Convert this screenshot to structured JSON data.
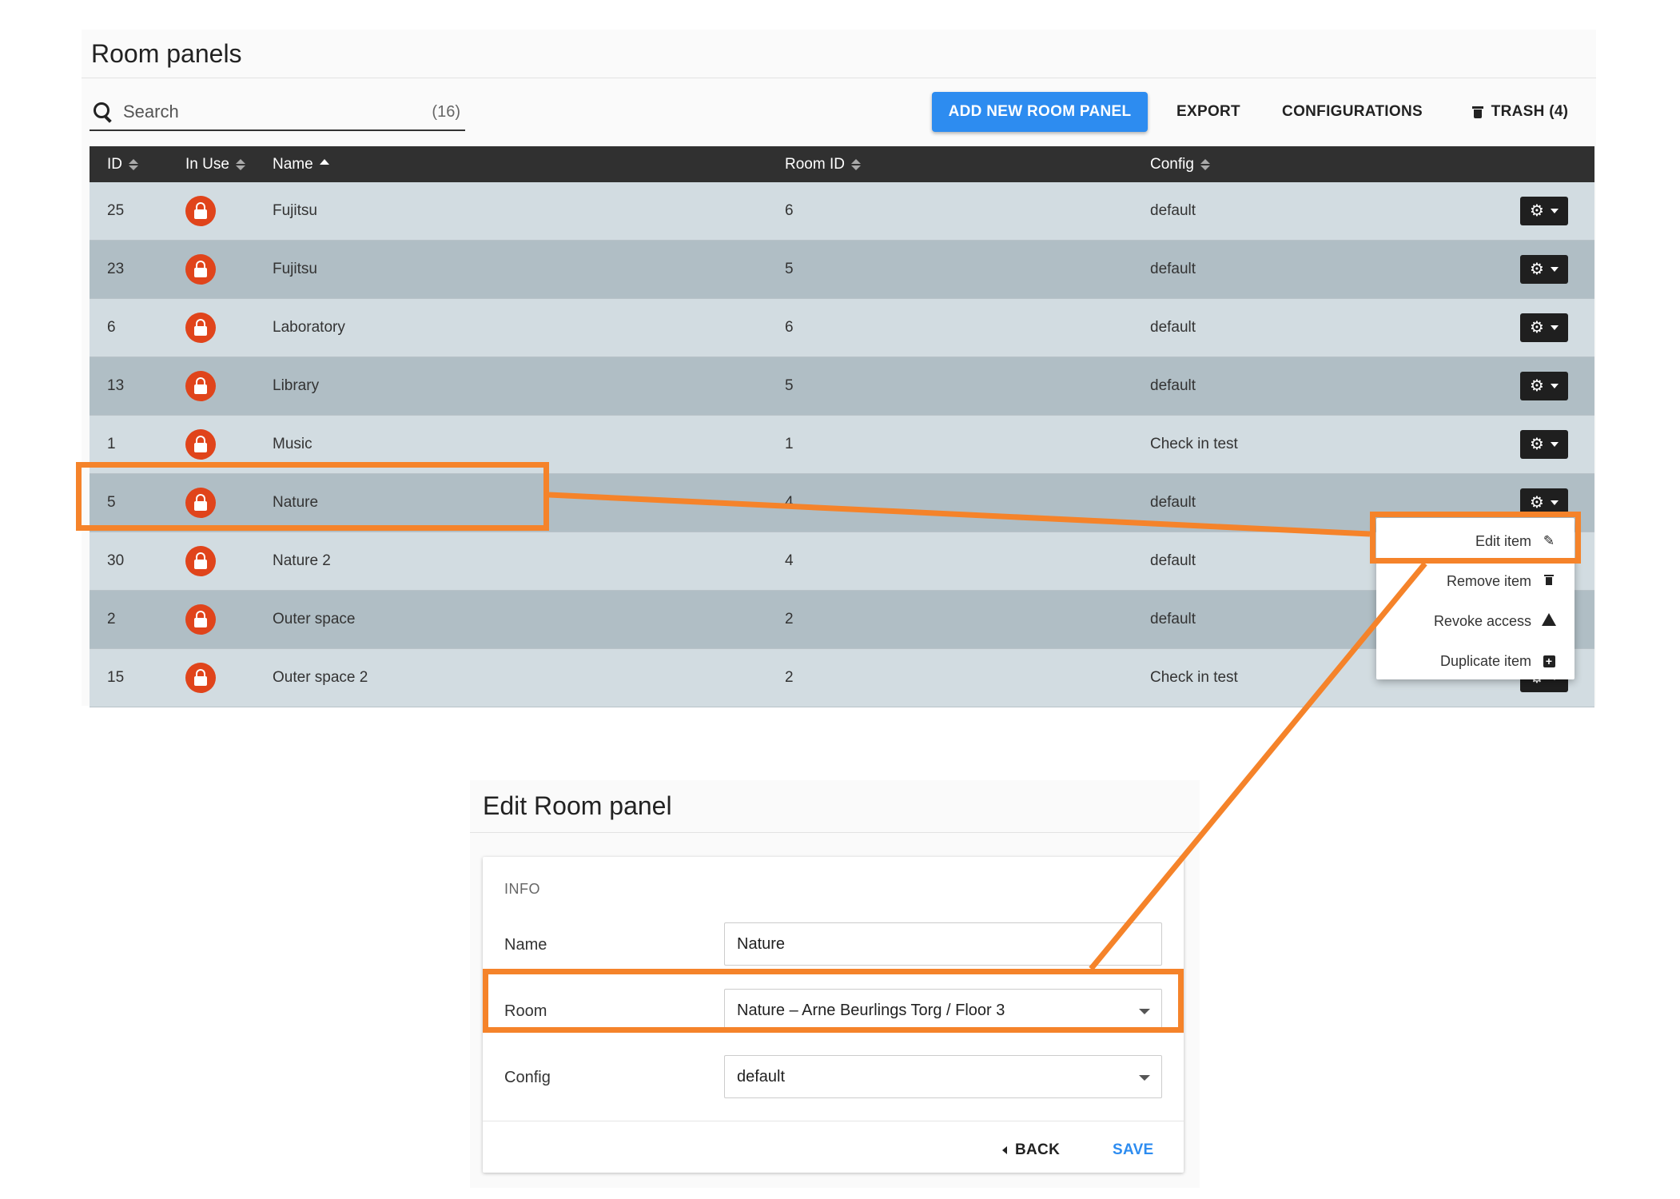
{
  "list_page": {
    "title": "Room panels",
    "search": {
      "placeholder": "Search",
      "value": "",
      "count": "(16)"
    },
    "toolbar": {
      "add_label": "ADD NEW ROOM PANEL",
      "export_label": "EXPORT",
      "configurations_label": "CONFIGURATIONS",
      "trash_label": "TRASH (4)"
    },
    "columns": [
      "ID",
      "In Use",
      "Name",
      "Room ID",
      "Config"
    ],
    "rows": [
      {
        "id": "25",
        "name": "Fujitsu",
        "room_id": "6",
        "config": "default"
      },
      {
        "id": "23",
        "name": "Fujitsu",
        "room_id": "5",
        "config": "default"
      },
      {
        "id": "6",
        "name": "Laboratory",
        "room_id": "6",
        "config": "default"
      },
      {
        "id": "13",
        "name": "Library",
        "room_id": "5",
        "config": "default"
      },
      {
        "id": "1",
        "name": "Music",
        "room_id": "1",
        "config": "Check in test"
      },
      {
        "id": "5",
        "name": "Nature",
        "room_id": "4",
        "config": "default"
      },
      {
        "id": "30",
        "name": "Nature 2",
        "room_id": "4",
        "config": "default"
      },
      {
        "id": "2",
        "name": "Outer space",
        "room_id": "2",
        "config": "default"
      },
      {
        "id": "15",
        "name": "Outer space 2",
        "room_id": "2",
        "config": "Check in test"
      }
    ],
    "row_menu": {
      "edit": "Edit item",
      "remove": "Remove item",
      "revoke": "Revoke access",
      "duplicate": "Duplicate item"
    }
  },
  "edit_page": {
    "title": "Edit Room panel",
    "section": "INFO",
    "name_label": "Name",
    "name_value": "Nature",
    "room_label": "Room",
    "room_value": "Nature – Arne Beurlings Torg / Floor 3",
    "config_label": "Config",
    "config_value": "default",
    "back_label": "BACK",
    "save_label": "SAVE"
  },
  "colors": {
    "primary": "#2d8cf0",
    "header_dark": "#303030",
    "row_light": "#d2dce1",
    "row_dark": "#b0bec5",
    "lock_badge": "#e0441b",
    "callout": "#f5832a"
  }
}
